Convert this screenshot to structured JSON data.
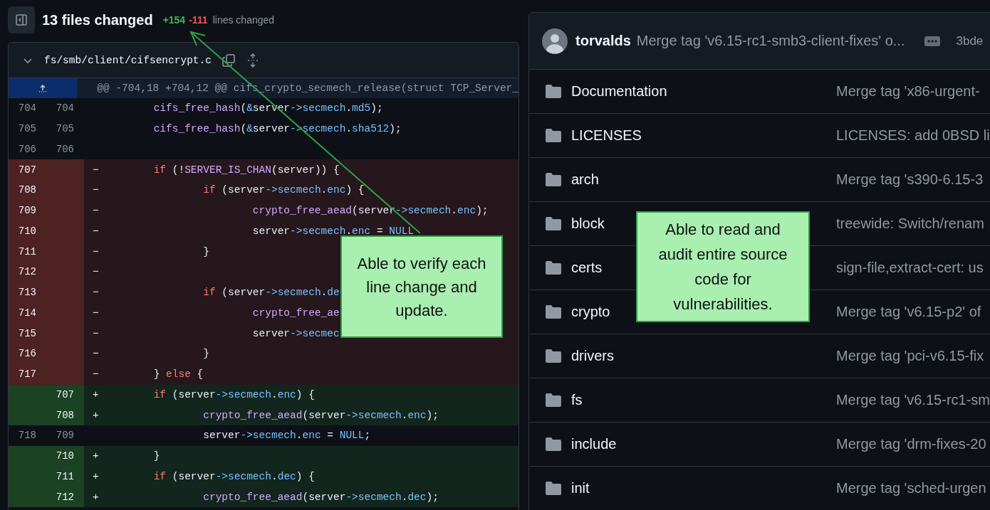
{
  "diff_header": {
    "title": "13 files changed",
    "additions": "+154",
    "deletions": "-111",
    "label": "lines changed"
  },
  "file": {
    "path": "fs/smb/client/cifsencrypt.c",
    "hunk": "@@ -704,18 +704,12 @@ cifs_crypto_secmech_release(struct TCP_Server_",
    "lines": [
      {
        "kind": "context",
        "old": "704",
        "new": "704",
        "tokens": [
          {
            "text": "\tcifs_free_hash",
            "kind": "function"
          },
          {
            "text": "(",
            "kind": "plain"
          },
          {
            "text": "&",
            "kind": "property"
          },
          {
            "text": "server",
            "kind": "plain"
          },
          {
            "text": "->secmech",
            "kind": "property"
          },
          {
            "text": ".",
            "kind": "plain"
          },
          {
            "text": "md5",
            "kind": "property"
          },
          {
            "text": ");",
            "kind": "plain"
          }
        ]
      },
      {
        "kind": "context",
        "old": "705",
        "new": "705",
        "tokens": [
          {
            "text": "\tcifs_free_hash",
            "kind": "function"
          },
          {
            "text": "(",
            "kind": "plain"
          },
          {
            "text": "&",
            "kind": "property"
          },
          {
            "text": "server",
            "kind": "plain"
          },
          {
            "text": "->secmech",
            "kind": "property"
          },
          {
            "text": ".",
            "kind": "plain"
          },
          {
            "text": "sha512",
            "kind": "property"
          },
          {
            "text": ");",
            "kind": "plain"
          }
        ]
      },
      {
        "kind": "context",
        "old": "706",
        "new": "706"
      },
      {
        "kind": "del",
        "old": "707",
        "sign": "−",
        "tokens": [
          {
            "text": "\tif",
            "kind": "keyword"
          },
          {
            "text": " (!",
            "kind": "plain"
          },
          {
            "text": "SERVER_IS_CHAN",
            "kind": "function"
          },
          {
            "text": "(server)) {",
            "kind": "plain"
          }
        ]
      },
      {
        "kind": "del",
        "old": "708",
        "sign": "−",
        "tokens": [
          {
            "text": "\t\tif",
            "kind": "keyword"
          },
          {
            "text": " (server",
            "kind": "plain"
          },
          {
            "text": "->secmech",
            "kind": "property"
          },
          {
            "text": ".",
            "kind": "plain"
          },
          {
            "text": "enc",
            "kind": "property"
          },
          {
            "text": ") {",
            "kind": "plain"
          }
        ]
      },
      {
        "kind": "del",
        "old": "709",
        "sign": "−",
        "tokens": [
          {
            "text": "\t\t\tcrypto_free_aead",
            "kind": "function"
          },
          {
            "text": "(server",
            "kind": "plain"
          },
          {
            "text": "->secmech",
            "kind": "property"
          },
          {
            "text": ".",
            "kind": "plain"
          },
          {
            "text": "enc",
            "kind": "property"
          },
          {
            "text": ");",
            "kind": "plain"
          }
        ]
      },
      {
        "kind": "del",
        "old": "710",
        "sign": "−",
        "tokens": [
          {
            "text": "\t\t\tserver",
            "kind": "plain"
          },
          {
            "text": "->secmech",
            "kind": "property"
          },
          {
            "text": ".",
            "kind": "plain"
          },
          {
            "text": "enc",
            "kind": "property"
          },
          {
            "text": " = ",
            "kind": "plain"
          },
          {
            "text": "NULL",
            "kind": "property"
          }
        ]
      },
      {
        "kind": "del",
        "old": "711",
        "sign": "−",
        "tokens": [
          {
            "text": "\t\t}",
            "kind": "plain"
          }
        ]
      },
      {
        "kind": "del",
        "old": "712",
        "sign": "−"
      },
      {
        "kind": "del",
        "old": "713",
        "sign": "−",
        "tokens": [
          {
            "text": "\t\tif",
            "kind": "keyword"
          },
          {
            "text": " (server",
            "kind": "plain"
          },
          {
            "text": "->secmech",
            "kind": "property"
          },
          {
            "text": ".",
            "kind": "plain"
          },
          {
            "text": "de",
            "kind": "property"
          }
        ]
      },
      {
        "kind": "del",
        "old": "714",
        "sign": "−",
        "tokens": [
          {
            "text": "\t\t\tcrypto_free_ae",
            "kind": "function"
          }
        ]
      },
      {
        "kind": "del",
        "old": "715",
        "sign": "−",
        "tokens": [
          {
            "text": "\t\t\tserver",
            "kind": "plain"
          },
          {
            "text": "->secmec",
            "kind": "property"
          }
        ]
      },
      {
        "kind": "del",
        "old": "716",
        "sign": "−",
        "tokens": [
          {
            "text": "\t\t}",
            "kind": "plain"
          }
        ]
      },
      {
        "kind": "del",
        "old": "717",
        "sign": "−",
        "tokens": [
          {
            "text": "\t} ",
            "kind": "plain"
          },
          {
            "text": "else",
            "kind": "keyword"
          },
          {
            "text": " {",
            "kind": "plain"
          }
        ]
      },
      {
        "kind": "add",
        "new": "707",
        "sign": "+",
        "tokens": [
          {
            "text": "\tif",
            "kind": "keyword"
          },
          {
            "text": " (server",
            "kind": "plain"
          },
          {
            "text": "->secmech",
            "kind": "property"
          },
          {
            "text": ".",
            "kind": "plain"
          },
          {
            "text": "enc",
            "kind": "property"
          },
          {
            "text": ") {",
            "kind": "plain"
          }
        ]
      },
      {
        "kind": "add",
        "new": "708",
        "sign": "+",
        "tokens": [
          {
            "text": "\t\tcrypto_free_aead",
            "kind": "function"
          },
          {
            "text": "(server",
            "kind": "plain"
          },
          {
            "text": "->secmech",
            "kind": "property"
          },
          {
            "text": ".",
            "kind": "plain"
          },
          {
            "text": "enc",
            "kind": "property"
          },
          {
            "text": ");",
            "kind": "plain"
          }
        ]
      },
      {
        "kind": "context",
        "old": "718",
        "new": "709",
        "tokens": [
          {
            "text": "\t\tserver",
            "kind": "plain"
          },
          {
            "text": "->secmech",
            "kind": "property"
          },
          {
            "text": ".",
            "kind": "plain"
          },
          {
            "text": "enc",
            "kind": "property"
          },
          {
            "text": " = ",
            "kind": "plain"
          },
          {
            "text": "NULL",
            "kind": "property"
          },
          {
            "text": ";",
            "kind": "plain"
          }
        ]
      },
      {
        "kind": "add",
        "new": "710",
        "sign": "+",
        "tokens": [
          {
            "text": "\t}",
            "kind": "plain"
          }
        ]
      },
      {
        "kind": "add",
        "new": "711",
        "sign": "+",
        "tokens": [
          {
            "text": "\tif",
            "kind": "keyword"
          },
          {
            "text": " (server",
            "kind": "plain"
          },
          {
            "text": "->secmech",
            "kind": "property"
          },
          {
            "text": ".",
            "kind": "plain"
          },
          {
            "text": "dec",
            "kind": "property"
          },
          {
            "text": ") {",
            "kind": "plain"
          }
        ]
      },
      {
        "kind": "add",
        "new": "712",
        "sign": "+",
        "tokens": [
          {
            "text": "\t\tcrypto_free_aead",
            "kind": "function"
          },
          {
            "text": "(server",
            "kind": "plain"
          },
          {
            "text": "->secmech",
            "kind": "property"
          },
          {
            "text": ".",
            "kind": "plain"
          },
          {
            "text": "dec",
            "kind": "property"
          },
          {
            "text": ");",
            "kind": "plain"
          }
        ]
      }
    ]
  },
  "repo": {
    "latest_commit": {
      "author": "torvalds",
      "message": "Merge tag 'v6.15-rc1-smb3-client-fixes' o...",
      "hash": "3bde"
    },
    "items": [
      {
        "name": "Documentation",
        "message": "Merge tag 'x86-urgent-"
      },
      {
        "name": "LICENSES",
        "message": "LICENSES: add 0BSD li"
      },
      {
        "name": "arch",
        "message": "Merge tag 's390-6.15-3"
      },
      {
        "name": "block",
        "message": "treewide: Switch/renam"
      },
      {
        "name": "certs",
        "message": "sign-file,extract-cert: us"
      },
      {
        "name": "crypto",
        "message": "Merge tag 'v6.15-p2' of"
      },
      {
        "name": "drivers",
        "message": "Merge tag 'pci-v6.15-fix"
      },
      {
        "name": "fs",
        "message": "Merge tag 'v6.15-rc1-sm"
      },
      {
        "name": "include",
        "message": "Merge tag 'drm-fixes-20"
      },
      {
        "name": "init",
        "message": "Merge tag 'sched-urgen"
      }
    ]
  },
  "callouts": [
    {
      "text": "Able to verify each line change and update."
    },
    {
      "text": "Able to read and audit entire source code for vulnerabilities."
    }
  ]
}
